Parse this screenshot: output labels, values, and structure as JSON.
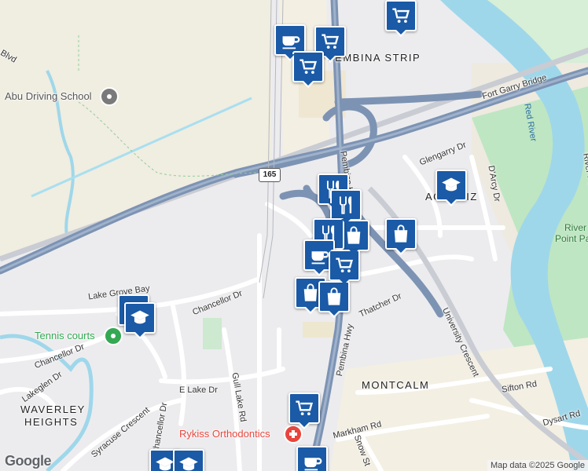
{
  "map": {
    "areas": [
      {
        "id": "pembina-strip",
        "text": "PEMBINA STRIP"
      },
      {
        "id": "agassiz",
        "text": "AGASSIZ"
      },
      {
        "id": "montcalm",
        "text": "MONTCALM"
      },
      {
        "id": "waverley-heights-1",
        "text": "WAVERLEY"
      },
      {
        "id": "waverley-heights-2",
        "text": "HEIGHTS"
      }
    ],
    "roads": [
      {
        "id": "fort-garry-bridge",
        "text": "Fort Garry Bridge"
      },
      {
        "id": "pembina-hwy-north",
        "text": "Pembina Hwy"
      },
      {
        "id": "pembina-hwy-south",
        "text": "Pembina Hwy"
      },
      {
        "id": "university-crescent",
        "text": "University Crescent"
      },
      {
        "id": "glengarry-dr",
        "text": "Glengarry Dr"
      },
      {
        "id": "darcy-dr",
        "text": "D'Arcy Dr"
      },
      {
        "id": "river-pointe-blvd",
        "text": "River Pointe Bl"
      },
      {
        "id": "thatcher-dr",
        "text": "Thatcher Dr"
      },
      {
        "id": "chancellor-dr-1",
        "text": "Chancellor Dr"
      },
      {
        "id": "chancellor-dr-2",
        "text": "Chancellor Dr"
      },
      {
        "id": "chancellor-dr-3",
        "text": "Chancellor Dr"
      },
      {
        "id": "lake-grove-bay",
        "text": "Lake Grove Bay"
      },
      {
        "id": "lakeglen-dr",
        "text": "Lakeglen Dr"
      },
      {
        "id": "e-lake-dr",
        "text": "E Lake Dr"
      },
      {
        "id": "gull-lake-rd",
        "text": "Gull Lake Rd"
      },
      {
        "id": "syracuse-crescent",
        "text": "Syracuse Crescent"
      },
      {
        "id": "markham-rd",
        "text": "Markham Rd"
      },
      {
        "id": "snow-st",
        "text": "Snow St"
      },
      {
        "id": "sifton-rd",
        "text": "Sifton Rd"
      },
      {
        "id": "dysart-rd",
        "text": "Dysart Rd"
      },
      {
        "id": "blvd-fragment",
        "text": "Blvd"
      }
    ],
    "water": [
      {
        "id": "red-river",
        "text": "Red River"
      }
    ],
    "parks": [
      {
        "id": "river-point-park-1",
        "text": "River"
      },
      {
        "id": "river-point-park-2",
        "text": "Point Park"
      }
    ],
    "pois": [
      {
        "id": "abu-driving-school",
        "text": "Abu Driving School",
        "color": "#7a7a7a"
      },
      {
        "id": "tennis-courts",
        "text": "Tennis courts",
        "color": "#34a853"
      },
      {
        "id": "rykiss-orthodontics",
        "text": "Rykiss Orthodontics",
        "color": "#e8453c"
      }
    ],
    "route_shield": "165",
    "markers": [
      {
        "id": "m1",
        "icon": "cart"
      },
      {
        "id": "m2",
        "icon": "coffee"
      },
      {
        "id": "m3",
        "icon": "cart"
      },
      {
        "id": "m4",
        "icon": "cart"
      },
      {
        "id": "m5",
        "icon": "restaurant"
      },
      {
        "id": "m6",
        "icon": "restaurant"
      },
      {
        "id": "m7",
        "icon": "school"
      },
      {
        "id": "m8",
        "icon": "bag"
      },
      {
        "id": "m9",
        "icon": "bag"
      },
      {
        "id": "m10",
        "icon": "restaurant"
      },
      {
        "id": "m11",
        "icon": "coffee"
      },
      {
        "id": "m12",
        "icon": "cart"
      },
      {
        "id": "m13",
        "icon": "bag"
      },
      {
        "id": "m14",
        "icon": "bag"
      },
      {
        "id": "m15",
        "icon": "school"
      },
      {
        "id": "m16",
        "icon": "school"
      },
      {
        "id": "m17",
        "icon": "cart"
      },
      {
        "id": "m18",
        "icon": "coffee"
      },
      {
        "id": "m19",
        "icon": "school"
      },
      {
        "id": "m20",
        "icon": "school"
      }
    ],
    "colors": {
      "marker": "#1a5aa6",
      "highway": "#7d93b3",
      "river": "#9fd7ea",
      "park": "#bfe6c2"
    },
    "attribution": "Map data ©2025 Google",
    "logo": "Google"
  }
}
